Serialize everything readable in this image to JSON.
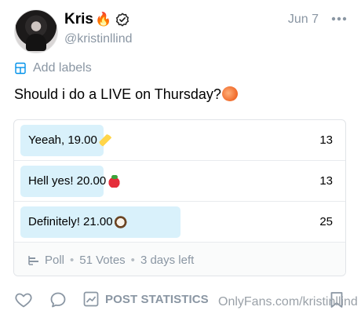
{
  "post": {
    "display_name": "Kris",
    "username": "@kristinllind",
    "date": "Jun 7",
    "labels_text": "Add labels",
    "text": "Should i do a LIVE on Thursday?"
  },
  "poll": {
    "options": [
      {
        "label": "Yeeah, 19.00",
        "emoji": "banana-icon",
        "count": "13",
        "fill": 0.26
      },
      {
        "label": "Hell yes! 20.00",
        "emoji": "strawberry-icon",
        "count": "13",
        "fill": 0.26
      },
      {
        "label": "Definitely! 21.00",
        "emoji": "coconut-icon",
        "count": "25",
        "fill": 0.5
      }
    ],
    "footer": {
      "type": "Poll",
      "votes": "51 Votes",
      "time_left": "3 days left"
    }
  },
  "actions": {
    "stats_label": "POST STATISTICS"
  },
  "watermark": "OnlyFans.com/kristinllind",
  "colors": {
    "accent_light": "#d9f1fb",
    "muted": "#8a96a3",
    "border": "#e1e4e8"
  }
}
